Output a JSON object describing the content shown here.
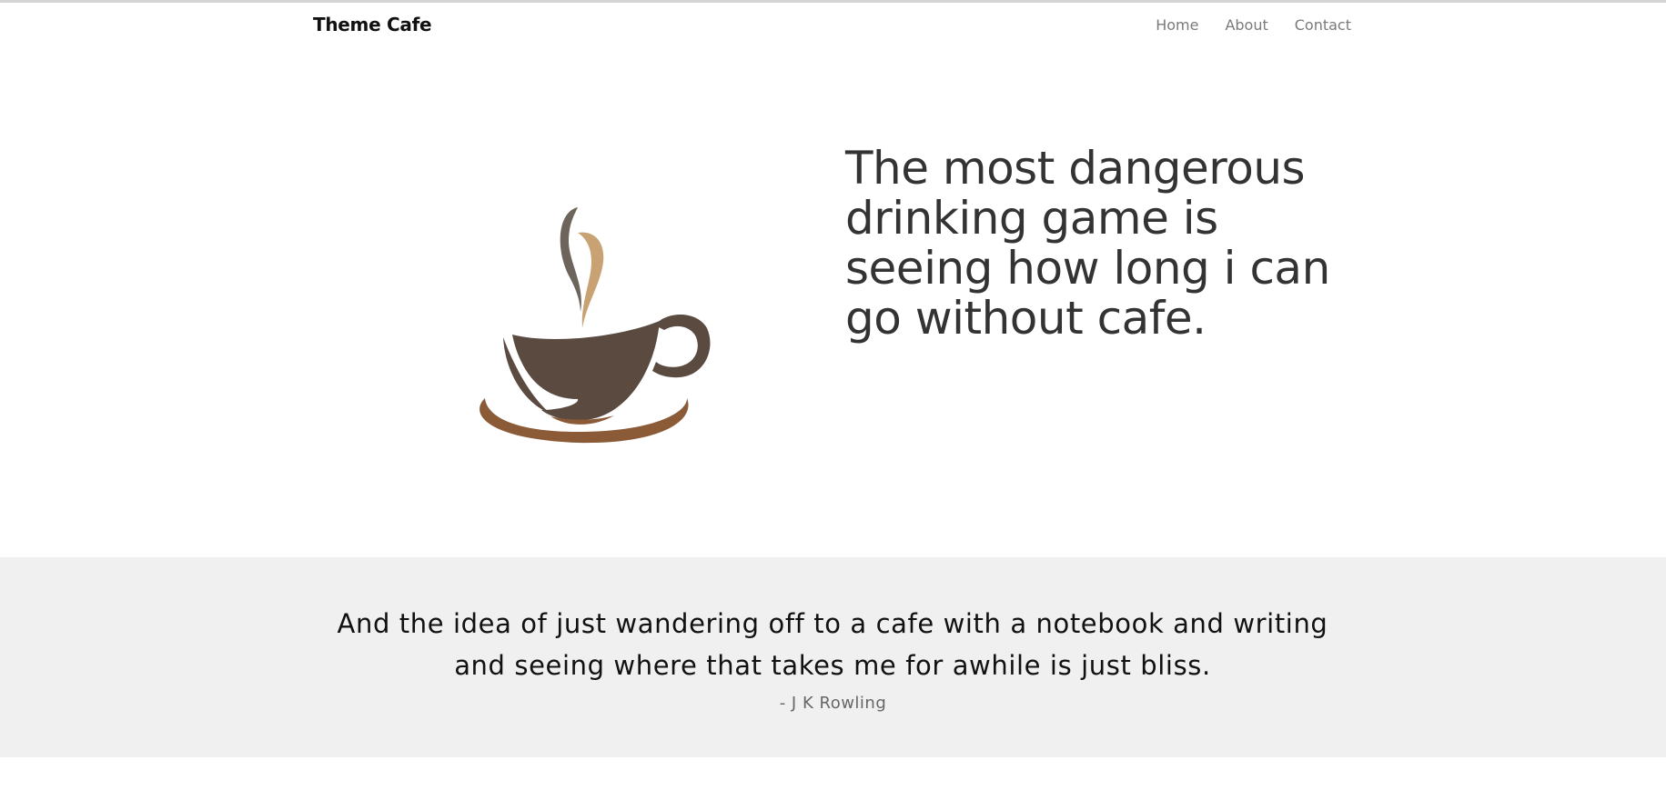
{
  "nav": {
    "brand": "Theme Cafe",
    "links": [
      {
        "label": "Home"
      },
      {
        "label": "About"
      },
      {
        "label": "Contact"
      }
    ]
  },
  "hero": {
    "logo_icon": "coffee-cup-icon",
    "heading": "The most dangerous drinking game is seeing how long i can go without cafe.",
    "colors": {
      "cup": "#5a4a40",
      "saucer": "#8b5a36",
      "steam_dark": "#6d645c",
      "steam_light": "#c8a273"
    }
  },
  "quote": {
    "text": "And the idea of just wandering off to a cafe with a notebook and writing and seeing where that takes me for awhile is just bliss.",
    "author": "- J K Rowling"
  }
}
